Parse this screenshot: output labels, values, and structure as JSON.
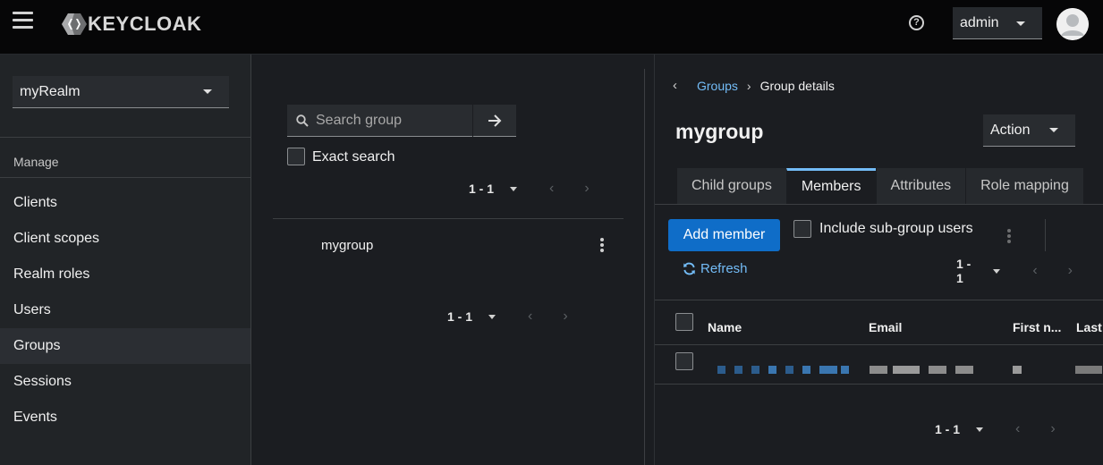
{
  "header": {
    "logo_text": "KEYCLOAK",
    "help_glyph": "?",
    "user": "admin"
  },
  "sidebar": {
    "realm": "myRealm",
    "section_title": "Manage",
    "items": [
      {
        "label": "Clients"
      },
      {
        "label": "Client scopes"
      },
      {
        "label": "Realm roles"
      },
      {
        "label": "Users"
      },
      {
        "label": "Groups",
        "active": true
      },
      {
        "label": "Sessions"
      },
      {
        "label": "Events"
      }
    ]
  },
  "groups_panel": {
    "search_placeholder": "Search group",
    "exact_search_label": "Exact search",
    "pagination_top": "1 - 1",
    "pagination_bottom": "1 - 1",
    "groups": [
      {
        "name": "mygroup"
      }
    ]
  },
  "details": {
    "breadcrumb": {
      "parent": "Groups",
      "current": "Group details"
    },
    "title": "mygroup",
    "action_label": "Action",
    "tabs": [
      {
        "label": "Child groups"
      },
      {
        "label": "Members",
        "active": true
      },
      {
        "label": "Attributes"
      },
      {
        "label": "Role mapping"
      }
    ],
    "add_member_label": "Add member",
    "include_subgroup_label": "Include sub-group users",
    "refresh_label": "Refresh",
    "pagination_top": "1 - 1",
    "pagination_bottom": "1 - 1",
    "columns": [
      "Name",
      "Email",
      "First n...",
      "Last"
    ]
  },
  "colors": {
    "accent": "#73bcf7",
    "primary_button": "#0f6dc8",
    "header_bg": "#060607",
    "sidebar_bg": "#212427",
    "content_bg": "#1b1d21"
  },
  "icons": [
    "hamburger-icon",
    "keycloak-logo-icon",
    "help-icon",
    "user-avatar-icon",
    "search-icon",
    "arrow-right-icon",
    "kebab-icon",
    "refresh-icon",
    "chevron-left-icon",
    "chevron-right-icon"
  ]
}
